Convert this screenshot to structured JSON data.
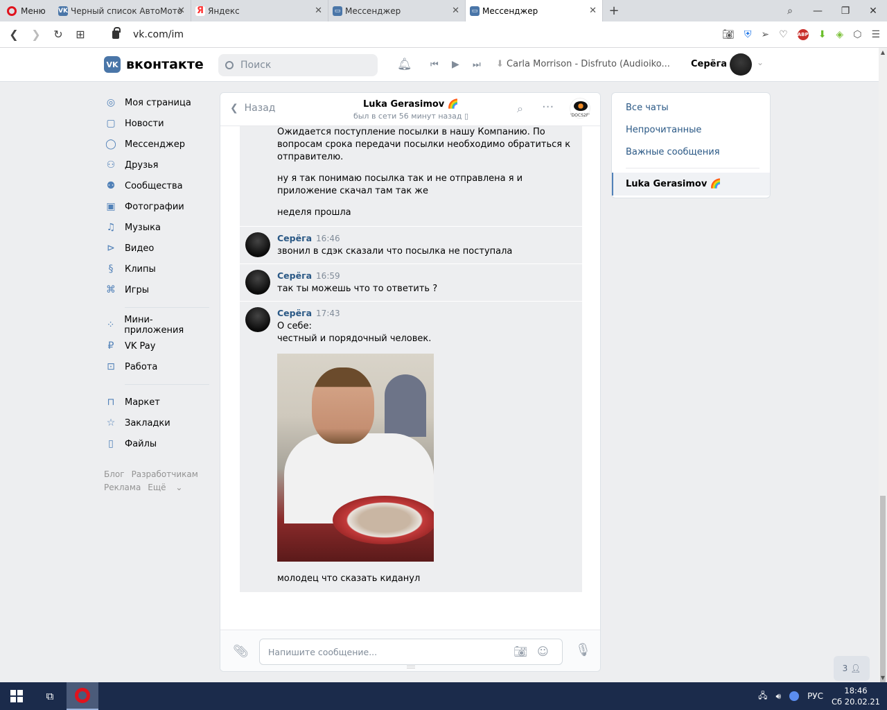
{
  "browser": {
    "menu_label": "Меню",
    "tabs": [
      {
        "title": "Черный список АвтоМото",
        "active": false
      },
      {
        "title": "Яндекс",
        "active": false
      },
      {
        "title": "Мессенджер",
        "active": false
      },
      {
        "title": "Мессенджер",
        "active": true
      }
    ],
    "url": "vk.com/im",
    "abp_label": "ABP",
    "abp_count": "1"
  },
  "header": {
    "logo_text": "вконтакте",
    "logo_mark": "VK",
    "search_placeholder": "Поиск",
    "now_playing": "Carla Morrison - Disfruto (Audioiko...",
    "user_name": "Серёга"
  },
  "leftnav": {
    "main": [
      {
        "label": "Моя страница",
        "icon": "user-circle-icon"
      },
      {
        "label": "Новости",
        "icon": "news-icon"
      },
      {
        "label": "Мессенджер",
        "icon": "message-icon"
      },
      {
        "label": "Друзья",
        "icon": "friends-icon"
      },
      {
        "label": "Сообщества",
        "icon": "communities-icon"
      },
      {
        "label": "Фотографии",
        "icon": "photo-icon"
      },
      {
        "label": "Музыка",
        "icon": "music-icon"
      },
      {
        "label": "Видео",
        "icon": "video-icon"
      },
      {
        "label": "Клипы",
        "icon": "clips-icon"
      },
      {
        "label": "Игры",
        "icon": "games-icon"
      }
    ],
    "apps": [
      {
        "label": "Мини-приложения",
        "icon": "apps-icon"
      },
      {
        "label": "VK Pay",
        "icon": "vkpay-icon"
      },
      {
        "label": "Работа",
        "icon": "work-icon"
      }
    ],
    "more": [
      {
        "label": "Маркет",
        "icon": "market-icon"
      },
      {
        "label": "Закладки",
        "icon": "bookmark-icon"
      },
      {
        "label": "Файлы",
        "icon": "files-icon"
      }
    ],
    "footer": {
      "blog": "Блог",
      "dev": "Разработчикам",
      "ads": "Реклама",
      "more": "Ещё"
    }
  },
  "chat": {
    "back_label": "Назад",
    "peer_name": "Luka Gerasimov 🌈",
    "peer_status": "был в сети 56 минут назад",
    "peer_avatar_text": "'DOCS2F'",
    "first_group": [
      "Ожидается поступление посылки в нашу Компанию. По вопросам срока передачи посылки необходимо обратиться к отправителю.",
      "ну я так понимаю посылка так и не отправлена я и приложение скачал там так же",
      "неделя прошла"
    ],
    "messages": [
      {
        "author": "Серёга",
        "time": "16:46",
        "lines": [
          "звонил в сдэк сказали что посылка не поступала"
        ]
      },
      {
        "author": "Серёга",
        "time": "16:59",
        "lines": [
          "так ты можешь что то ответить ?"
        ]
      },
      {
        "author": "Серёга",
        "time": "17:43",
        "lines": [
          "О себе:",
          "честный и порядочный человек."
        ],
        "has_photo": true,
        "after_photo": "молодец что сказать киданул"
      }
    ],
    "composer_placeholder": "Напишите сообщение..."
  },
  "filters": {
    "items": [
      "Все чаты",
      "Непрочитанные",
      "Важные сообщения"
    ],
    "active_peer": "Luka Gerasimov 🌈"
  },
  "friends_badge": "3",
  "taskbar": {
    "lang": "РУС",
    "time": "18:46",
    "date": "Сб 20.02.21"
  }
}
